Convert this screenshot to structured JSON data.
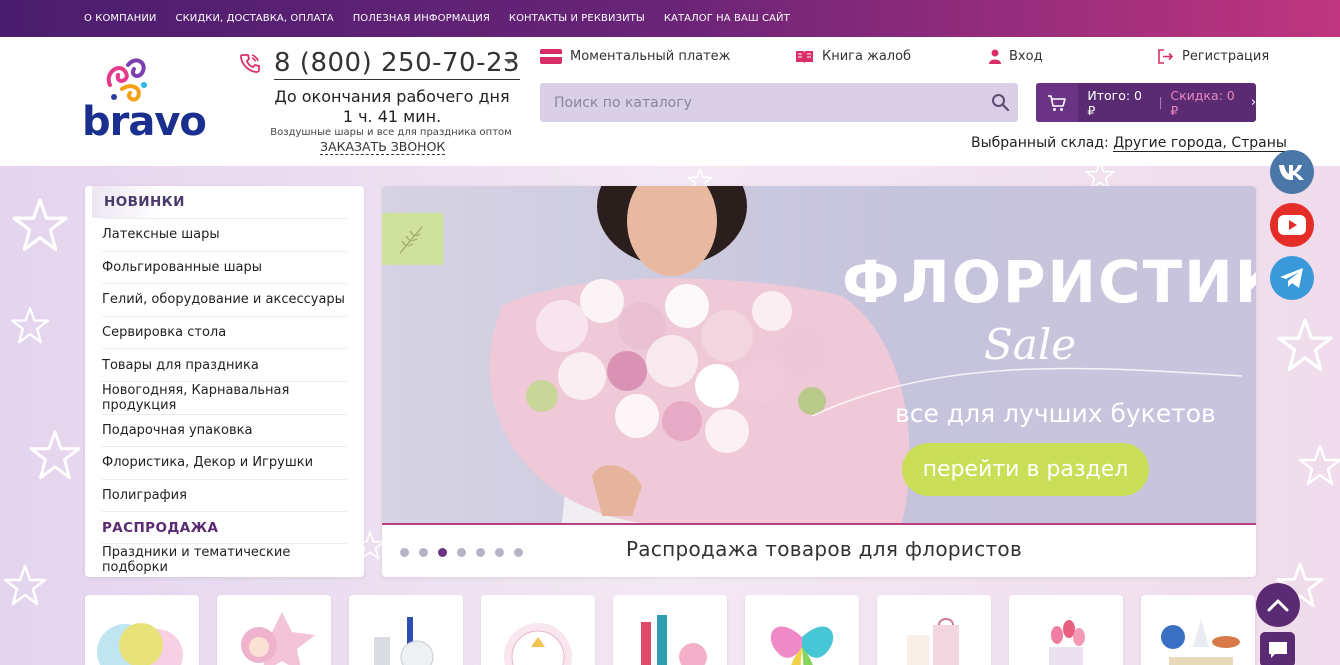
{
  "topnav": [
    "О КОМПАНИИ",
    "СКИДКИ, ДОСТАВКА, ОПЛАТА",
    "ПОЛЕЗНАЯ ИНФОРМАЦИЯ",
    "КОНТАКТЫ И РЕКВИЗИТЫ",
    "КАТАЛОГ НА ВАШ САЙТ"
  ],
  "logo": {
    "text": "bravo"
  },
  "phone": {
    "number": "8 (800) 250-70-23",
    "work_end": "До окончания рабочего дня",
    "work_time": "1 ч. 41 мин.",
    "subtitle": "Воздушные шары и все для праздника оптом",
    "callback": "ЗАКАЗАТЬ ЗВОНОК"
  },
  "header_links": {
    "payment": "Моментальный платеж",
    "complaints": "Книга жалоб",
    "login": "Вход",
    "register": "Регистрация"
  },
  "search": {
    "placeholder": "Поиск по каталогу"
  },
  "cart": {
    "total": "Итого: 0 ₽",
    "discount": "Скидка: 0 ₽"
  },
  "warehouse": {
    "label": "Выбранный склад:",
    "value": "Другие города, Страны"
  },
  "sidebar": {
    "new_heading": "НОВИНКИ",
    "items": [
      "Латексные шары",
      "Фольгированные шары",
      "Гелий, оборудование и аксессуары",
      "Сервировка стола",
      "Товары для праздника",
      "Новогодняя, Карнавальная продукция",
      "Подарочная упаковка",
      "Флористика, Декор и Игрушки",
      "Полиграфия"
    ],
    "sale_heading": "РАСПРОДАЖА",
    "last_item": "Праздники и тематические подборки"
  },
  "banner": {
    "title": "ФЛОРИСТИКА",
    "sale": "Sale",
    "subtitle": "все для лучших букетов",
    "button": "перейти в раздел",
    "caption": "Распродажа товаров для флористов",
    "dots_count": 7,
    "active_dot": 3
  },
  "colors": {
    "accent": "#5a2a72",
    "pink": "#d92e6a",
    "lime": "#cadf57"
  }
}
